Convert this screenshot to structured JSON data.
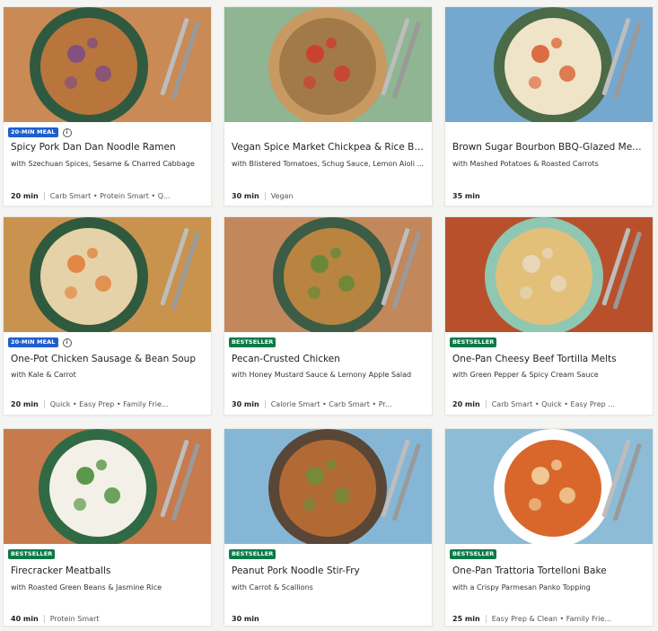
{
  "recipes": [
    {
      "badge": "20-MIN MEAL",
      "badge_type": "meal",
      "info_icon": "info-circle-icon",
      "title": "Spicy Pork Dan Dan Noodle Ramen",
      "subtitle": "with Szechuan Spices, Sesame & Charred Cabbage",
      "time": "20 min",
      "tags": "Carb Smart • Protein Smart • Q...",
      "colors": {
        "bg": "#c98a55",
        "plate": "#2f5a40",
        "food": "#b8763d",
        "accent": "#7a4a8a"
      }
    },
    {
      "badge": "",
      "badge_type": "",
      "title": "Vegan Spice Market Chickpea & Rice Bowls",
      "subtitle": "with Blistered Tomatoes, Schug Sauce, Lemon Aioli ...",
      "time": "30 min",
      "tags": "Vegan",
      "colors": {
        "bg": "#8fb592",
        "plate": "#c89a62",
        "food": "#a27a4a",
        "accent": "#d4362b"
      }
    },
    {
      "badge": "",
      "badge_type": "",
      "title": "Brown Sugar Bourbon BBQ-Glazed Meatba...",
      "subtitle": "with Mashed Potatoes & Roasted Carrots",
      "time": "35 min",
      "tags": "",
      "colors": {
        "bg": "#74a8cf",
        "plate": "#4b6a48",
        "food": "#efe3c8",
        "accent": "#d8582a"
      }
    },
    {
      "badge": "20-MIN MEAL",
      "badge_type": "meal",
      "info_icon": "info-circle-icon",
      "title": "One-Pot Chicken Sausage & Bean Soup",
      "subtitle": "with Kale & Carrot",
      "time": "20 min",
      "tags": "Quick • Easy Prep • Family Frie...",
      "colors": {
        "bg": "#c9934f",
        "plate": "#2f5a3e",
        "food": "#e6d2a8",
        "accent": "#e07b33"
      }
    },
    {
      "badge": "BESTSELLER",
      "badge_type": "best",
      "title": "Pecan-Crusted Chicken",
      "subtitle": "with Honey Mustard Sauce & Lemony Apple Salad",
      "time": "30 min",
      "tags": "Calorie Smart • Carb Smart • Pr...",
      "colors": {
        "bg": "#c2875a",
        "plate": "#3c5c46",
        "food": "#b9843f",
        "accent": "#5a8a3a"
      }
    },
    {
      "badge": "BESTSELLER",
      "badge_type": "best",
      "title": "One-Pan Cheesy Beef Tortilla Melts",
      "subtitle": "with Green Pepper & Spicy Cream Sauce",
      "time": "20 min",
      "tags": "Carb Smart • Quick • Easy Prep ...",
      "colors": {
        "bg": "#b8512b",
        "plate": "#8fc7b2",
        "food": "#e2c07a",
        "accent": "#e8d9c3"
      }
    },
    {
      "badge": "BESTSELLER",
      "badge_type": "best",
      "title": "Firecracker Meatballs",
      "subtitle": "with Roasted Green Beans & Jasmine Rice",
      "time": "40 min",
      "tags": "Protein Smart",
      "colors": {
        "bg": "#c77a4c",
        "plate": "#2f6a44",
        "food": "#f3f0e8",
        "accent": "#3f8a2e"
      }
    },
    {
      "badge": "BESTSELLER",
      "badge_type": "best",
      "title": "Peanut Pork Noodle Stir-Fry",
      "subtitle": "with Carrot & Scallions",
      "time": "30 min",
      "tags": "",
      "colors": {
        "bg": "#86b6d6",
        "plate": "#5a4636",
        "food": "#b26a35",
        "accent": "#6b8f3a"
      }
    },
    {
      "badge": "BESTSELLER",
      "badge_type": "best",
      "title": "One-Pan Trattoria Tortelloni Bake",
      "subtitle": "with a Crispy Parmesan Panko Topping",
      "time": "25 min",
      "tags": "Easy Prep & Clean • Family Frie...",
      "colors": {
        "bg": "#8cbcd6",
        "plate": "#ffffff",
        "food": "#d9672c",
        "accent": "#f2d9a6"
      }
    }
  ]
}
